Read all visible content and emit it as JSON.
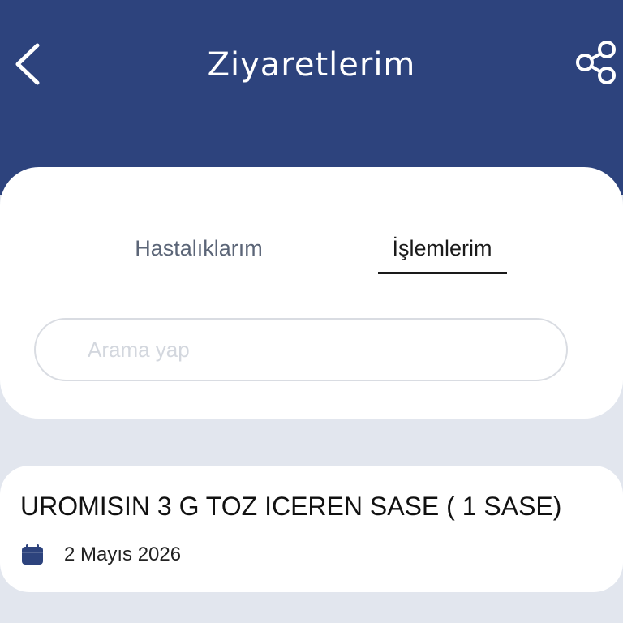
{
  "header": {
    "title": "Ziyaretlerim",
    "back_icon": "chevron-left-icon",
    "share_icon": "share-icon",
    "background_color": "#2d437d"
  },
  "tabs": [
    {
      "label": "Hastalıklarım",
      "active": false
    },
    {
      "label": "İşlemlerim",
      "active": true
    }
  ],
  "search": {
    "placeholder": "Arama yap",
    "value": ""
  },
  "visits": [
    {
      "title": "UROMISIN 3 G TOZ ICEREN SASE ( 1 SASE)",
      "date": "2 Mayıs 2026",
      "icon": "calendar-icon"
    }
  ],
  "colors": {
    "primary": "#2d437d",
    "page_background": "#e2e6ee",
    "card_background": "#ffffff"
  }
}
